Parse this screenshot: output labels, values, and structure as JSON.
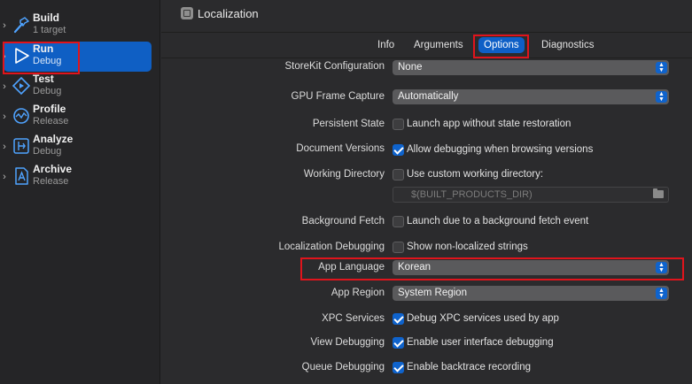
{
  "sidebar": {
    "actions": [
      {
        "title": "Build",
        "subtitle": "1 target"
      },
      {
        "title": "Run",
        "subtitle": "Debug"
      },
      {
        "title": "Test",
        "subtitle": "Debug"
      },
      {
        "title": "Profile",
        "subtitle": "Release"
      },
      {
        "title": "Analyze",
        "subtitle": "Debug"
      },
      {
        "title": "Archive",
        "subtitle": "Release"
      }
    ],
    "selected": "Run"
  },
  "header": {
    "title": "Localization"
  },
  "tabs": [
    {
      "label": "Info"
    },
    {
      "label": "Arguments"
    },
    {
      "label": "Options",
      "active": true
    },
    {
      "label": "Diagnostics"
    }
  ],
  "options": {
    "storekit": {
      "label": "StoreKit Configuration",
      "value": "None"
    },
    "gpu_frame_capture": {
      "label": "GPU Frame Capture",
      "value": "Automatically"
    },
    "persistent_state": {
      "label": "Persistent State",
      "option": "Launch app without state restoration",
      "checked": false
    },
    "document_versions": {
      "label": "Document Versions",
      "option": "Allow debugging when browsing versions",
      "checked": true
    },
    "working_directory": {
      "label": "Working Directory",
      "option": "Use custom working directory:",
      "checked": false,
      "placeholder": "$(BUILT_PRODUCTS_DIR)"
    },
    "background_fetch": {
      "label": "Background Fetch",
      "option": "Launch due to a background fetch event",
      "checked": false
    },
    "localization_debugging": {
      "label": "Localization Debugging",
      "option": "Show non-localized strings",
      "checked": false
    },
    "app_language": {
      "label": "App Language",
      "value": "Korean"
    },
    "app_region": {
      "label": "App Region",
      "value": "System Region"
    },
    "xpc_services": {
      "label": "XPC Services",
      "option": "Debug XPC services used by app",
      "checked": true
    },
    "view_debugging": {
      "label": "View Debugging",
      "option": "Enable user interface debugging",
      "checked": true
    },
    "queue_debugging": {
      "label": "Queue Debugging",
      "option": "Enable backtrace recording",
      "checked": true
    }
  },
  "colors": {
    "accent": "#0f63cc",
    "highlight": "#e0141c",
    "background": "#2b2b2d",
    "sidebar": "#252527"
  },
  "icons": [
    "hammer-icon",
    "play-icon",
    "test-diamond-icon",
    "profile-gauge-icon",
    "analyze-icon",
    "archive-icon",
    "folder-icon",
    "scheme-icon"
  ]
}
